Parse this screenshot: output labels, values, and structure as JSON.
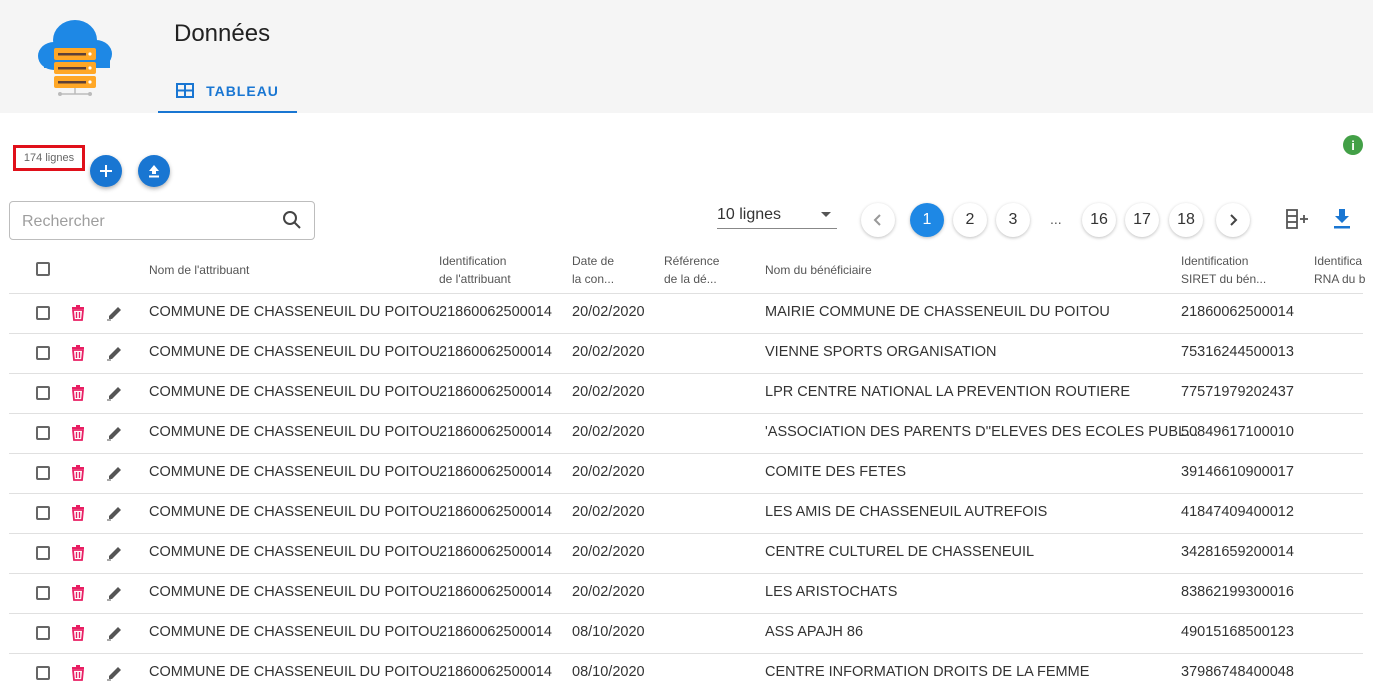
{
  "header": {
    "title": "Données",
    "tab_label": "TABLEAU"
  },
  "toolbar": {
    "row_count": "174 lignes"
  },
  "search": {
    "placeholder": "Rechercher"
  },
  "pagination": {
    "page_size": "10 lignes",
    "pages": [
      "1",
      "2",
      "3",
      "16",
      "17",
      "18"
    ],
    "ellipsis": "...",
    "current": "1"
  },
  "table": {
    "columns": [
      {
        "label": "Nom de l'attribuant"
      },
      {
        "label": "Identification",
        "label2": "de l'attribuant"
      },
      {
        "label": "Date de",
        "label2": "la con..."
      },
      {
        "label": "Référence",
        "label2": "de la dé..."
      },
      {
        "label": "Nom du bénéficiaire"
      },
      {
        "label": "Identification",
        "label2": "SIRET du bén..."
      },
      {
        "label": "Identifica",
        "label2": "RNA du b"
      }
    ],
    "rows": [
      {
        "attribuant": "COMMUNE DE CHASSENEUIL DU POITOU",
        "id_attribuant": "21860062500014",
        "date": "20/02/2020",
        "beneficiaire": "MAIRIE COMMUNE DE CHASSENEUIL DU POITOU",
        "siret": "21860062500014"
      },
      {
        "attribuant": "COMMUNE DE CHASSENEUIL DU POITOU",
        "id_attribuant": "21860062500014",
        "date": "20/02/2020",
        "beneficiaire": "VIENNE SPORTS ORGANISATION",
        "siret": "75316244500013"
      },
      {
        "attribuant": "COMMUNE DE CHASSENEUIL DU POITOU",
        "id_attribuant": "21860062500014",
        "date": "20/02/2020",
        "beneficiaire": "LPR CENTRE NATIONAL LA PREVENTION ROUTIERE",
        "siret": "77571979202437"
      },
      {
        "attribuant": "COMMUNE DE CHASSENEUIL DU POITOU",
        "id_attribuant": "21860062500014",
        "date": "20/02/2020",
        "beneficiaire": "'ASSOCIATION DES PARENTS D''ELEVES DES ECOLES PUBL...",
        "siret": "50849617100010"
      },
      {
        "attribuant": "COMMUNE DE CHASSENEUIL DU POITOU",
        "id_attribuant": "21860062500014",
        "date": "20/02/2020",
        "beneficiaire": "COMITE DES FETES",
        "siret": "39146610900017"
      },
      {
        "attribuant": "COMMUNE DE CHASSENEUIL DU POITOU",
        "id_attribuant": "21860062500014",
        "date": "20/02/2020",
        "beneficiaire": "LES AMIS DE CHASSENEUIL AUTREFOIS",
        "siret": "41847409400012"
      },
      {
        "attribuant": "COMMUNE DE CHASSENEUIL DU POITOU",
        "id_attribuant": "21860062500014",
        "date": "20/02/2020",
        "beneficiaire": "CENTRE CULTUREL DE CHASSENEUIL",
        "siret": "34281659200014"
      },
      {
        "attribuant": "COMMUNE DE CHASSENEUIL DU POITOU",
        "id_attribuant": "21860062500014",
        "date": "20/02/2020",
        "beneficiaire": "LES ARISTOCHATS",
        "siret": "83862199300016"
      },
      {
        "attribuant": "COMMUNE DE CHASSENEUIL DU POITOU",
        "id_attribuant": "21860062500014",
        "date": "08/10/2020",
        "beneficiaire": "ASS APAJH 86",
        "siret": "49015168500123"
      },
      {
        "attribuant": "COMMUNE DE CHASSENEUIL DU POITOU",
        "id_attribuant": "21860062500014",
        "date": "08/10/2020",
        "beneficiaire": "CENTRE INFORMATION DROITS DE LA FEMME",
        "siret": "37986748400048"
      }
    ]
  },
  "colors": {
    "accent": "#1976d2",
    "delete": "#e91e63",
    "info": "#43a047",
    "highlight": "#e0101a"
  },
  "icons": [
    "cloud-server-logo",
    "table-icon",
    "info-icon",
    "add-icon",
    "upload-icon",
    "search-icon",
    "chevron-left-icon",
    "chevron-right-icon",
    "add-column-icon",
    "download-icon",
    "delete-icon",
    "edit-icon"
  ]
}
